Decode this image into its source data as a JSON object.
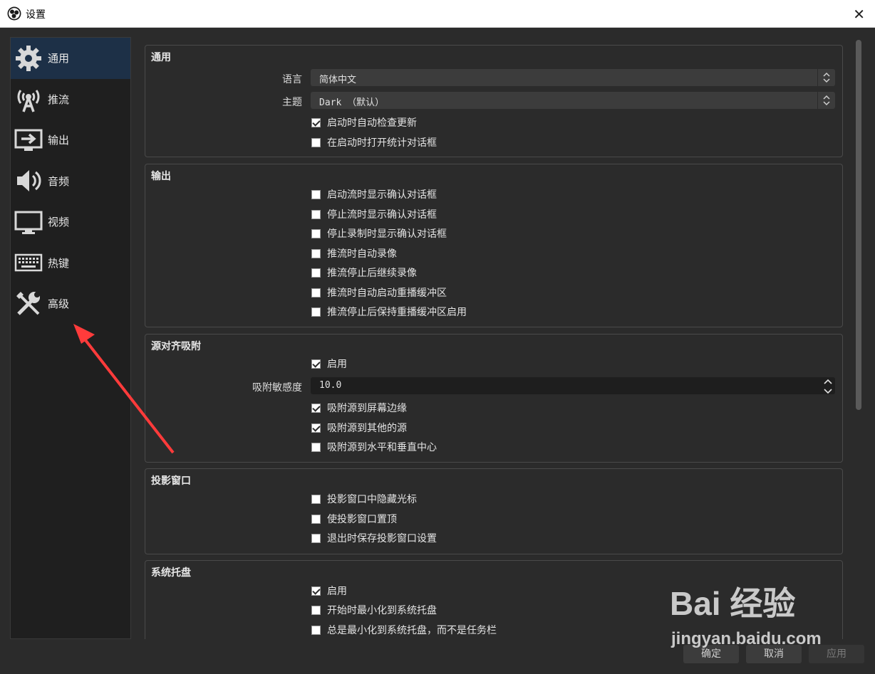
{
  "window": {
    "title": "设置"
  },
  "sidebar": {
    "items": [
      {
        "label": "通用",
        "icon": "gear-icon",
        "active": true
      },
      {
        "label": "推流",
        "icon": "broadcast-tower-icon"
      },
      {
        "label": "输出",
        "icon": "output-monitor-icon"
      },
      {
        "label": "音频",
        "icon": "speaker-icon"
      },
      {
        "label": "视频",
        "icon": "monitor-icon"
      },
      {
        "label": "热键",
        "icon": "keyboard-icon"
      },
      {
        "label": "高级",
        "icon": "tools-icon"
      }
    ]
  },
  "groups": {
    "general": {
      "title": "通用",
      "language_label": "语言",
      "language_value": "简体中文",
      "theme_label": "主题",
      "theme_value": "Dark （默认）",
      "checks": [
        {
          "label": "启动时自动检查更新",
          "checked": true
        },
        {
          "label": "在启动时打开统计对话框",
          "checked": false
        }
      ]
    },
    "output": {
      "title": "输出",
      "checks": [
        {
          "label": "启动流时显示确认对话框",
          "checked": false
        },
        {
          "label": "停止流时显示确认对话框",
          "checked": false
        },
        {
          "label": "停止录制时显示确认对话框",
          "checked": false
        },
        {
          "label": "推流时自动录像",
          "checked": false
        },
        {
          "label": "推流停止后继续录像",
          "checked": false
        },
        {
          "label": "推流时自动启动重播缓冲区",
          "checked": false
        },
        {
          "label": "推流停止后保持重播缓冲区启用",
          "checked": false
        }
      ]
    },
    "snapping": {
      "title": "源对齐吸附",
      "enable": {
        "label": "启用",
        "checked": true
      },
      "sensitivity_label": "吸附敏感度",
      "sensitivity_value": "10.0",
      "checks": [
        {
          "label": "吸附源到屏幕边缘",
          "checked": true
        },
        {
          "label": "吸附源到其他的源",
          "checked": true
        },
        {
          "label": "吸附源到水平和垂直中心",
          "checked": false
        }
      ]
    },
    "projector": {
      "title": "投影窗口",
      "checks": [
        {
          "label": "投影窗口中隐藏光标",
          "checked": false
        },
        {
          "label": "使投影窗口置顶",
          "checked": false
        },
        {
          "label": "退出时保存投影窗口设置",
          "checked": false
        }
      ]
    },
    "tray": {
      "title": "系统托盘",
      "checks": [
        {
          "label": "启用",
          "checked": true
        },
        {
          "label": "开始时最小化到系统托盘",
          "checked": false
        },
        {
          "label": "总是最小化到系统托盘，而不是任务栏",
          "checked": false
        }
      ]
    }
  },
  "footer": {
    "ok": "确定",
    "cancel": "取消",
    "apply": "应用"
  },
  "watermark": {
    "logo": "Bai 经验",
    "url": "jingyan.baidu.com"
  },
  "colors": {
    "active_nav": "#1d3047",
    "annotation_arrow": "#ff3b3b"
  }
}
